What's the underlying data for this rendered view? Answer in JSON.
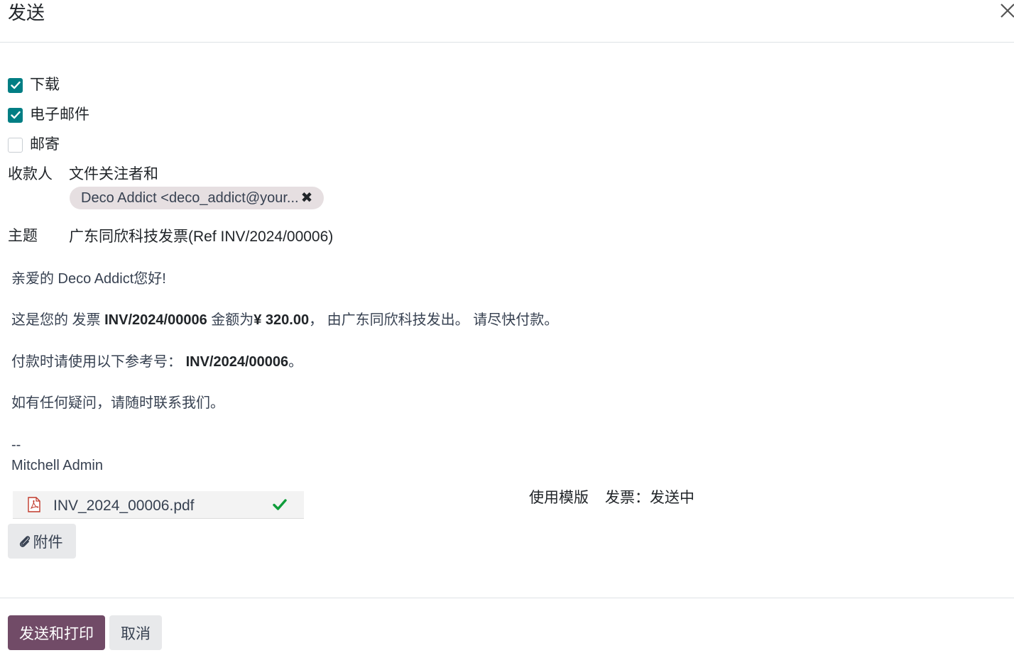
{
  "dialog": {
    "title": "发送",
    "close_icon": "close-icon"
  },
  "options": [
    {
      "label": "下载",
      "checked": true
    },
    {
      "label": "电子邮件",
      "checked": true
    },
    {
      "label": "邮寄",
      "checked": false
    }
  ],
  "recipients": {
    "label": "收款人",
    "prefix": "文件关注者和",
    "tags": [
      {
        "text": "Deco Addict <deco_addict@your...",
        "remove_icon": "remove-x-icon"
      }
    ]
  },
  "subject": {
    "label": "主题",
    "value": "广东同欣科技发票(Ref INV/2024/00006)"
  },
  "body": {
    "greeting": "亲爱的 Deco Addict您好!",
    "line1_part1": "这是您的 发票 ",
    "line1_invoice": "INV/2024/00006",
    "line1_part2": " 金额为",
    "line1_amount": "¥ 320.00",
    "line1_part3": "， 由广东同欣科技发出。 请尽快付款。",
    "line2_part1": "付款时请使用以下参考号：  ",
    "line2_ref": "INV/2024/00006",
    "line2_part2": "。",
    "line3": "如有任何疑问，请随时联系我们。",
    "signature_sep": "--",
    "signature_name": "Mitchell Admin"
  },
  "attachment": {
    "filename": "INV_2024_00006.pdf",
    "file_icon": "pdf-file-icon",
    "status_icon": "check-icon",
    "status_color": "#0f9d3a"
  },
  "template": {
    "label": "使用模版",
    "value": "发票：发送中"
  },
  "attach_button": {
    "label": "附件",
    "icon": "paperclip-icon"
  },
  "footer": {
    "primary_label": "发送和打印",
    "secondary_label": "取消"
  },
  "colors": {
    "primary": "#714b67",
    "checkbox": "#017e84",
    "tag_bg": "#e6dfe1"
  }
}
